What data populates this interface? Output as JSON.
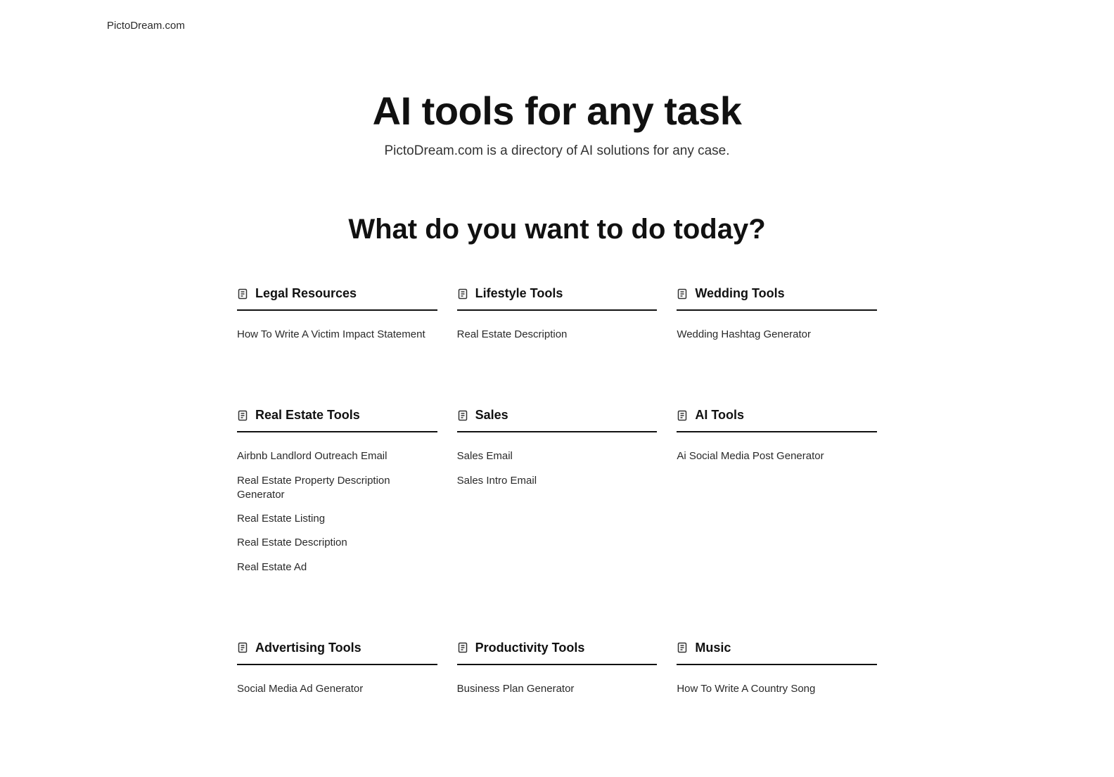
{
  "brand": "PictoDream.com",
  "hero": {
    "title": "AI tools for any task",
    "subtitle": "PictoDream.com is a directory of AI solutions for any case."
  },
  "section_heading": "What do you want to do today?",
  "categories": [
    {
      "title": "Legal Resources",
      "items": [
        "How To Write A Victim Impact Statement"
      ]
    },
    {
      "title": "Lifestyle Tools",
      "items": [
        "Real Estate Description"
      ]
    },
    {
      "title": "Wedding Tools",
      "items": [
        "Wedding Hashtag Generator"
      ]
    },
    {
      "title": "Real Estate Tools",
      "items": [
        "Airbnb Landlord Outreach Email",
        "Real Estate Property Description Generator",
        "Real Estate Listing",
        "Real Estate Description",
        "Real Estate Ad"
      ]
    },
    {
      "title": "Sales",
      "items": [
        "Sales Email",
        "Sales Intro Email"
      ]
    },
    {
      "title": "AI Tools",
      "items": [
        "Ai Social Media Post Generator"
      ]
    },
    {
      "title": "Advertising Tools",
      "items": [
        "Social Media Ad Generator"
      ]
    },
    {
      "title": "Productivity Tools",
      "items": [
        "Business Plan Generator"
      ]
    },
    {
      "title": "Music",
      "items": [
        "How To Write A Country Song"
      ]
    }
  ]
}
